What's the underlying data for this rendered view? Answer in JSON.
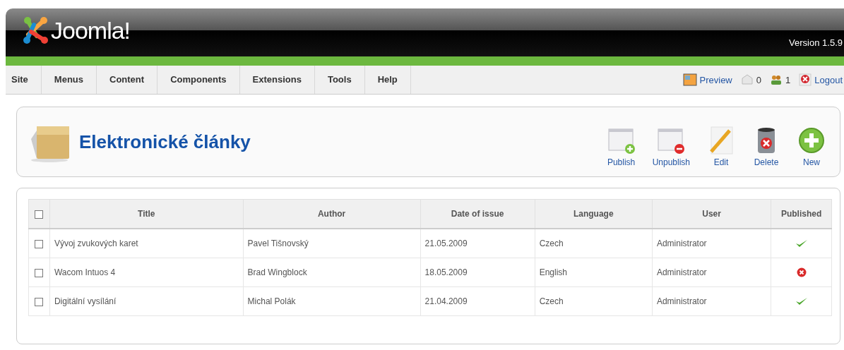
{
  "header": {
    "logo_text": "Joomla!",
    "version": "Version 1.5.9"
  },
  "menu": [
    "Site",
    "Menus",
    "Content",
    "Components",
    "Extensions",
    "Tools",
    "Help"
  ],
  "status": [
    {
      "kind": "preview",
      "label": "Preview"
    },
    {
      "kind": "messages",
      "label": "0"
    },
    {
      "kind": "users",
      "label": "1"
    },
    {
      "kind": "logout",
      "label": "Logout"
    }
  ],
  "page_title": "Elektronické články",
  "toolbar": [
    {
      "kind": "publish",
      "label": "Publish"
    },
    {
      "kind": "unpublish",
      "label": "Unpublish"
    },
    {
      "kind": "edit",
      "label": "Edit"
    },
    {
      "kind": "delete",
      "label": "Delete"
    },
    {
      "kind": "new",
      "label": "New"
    }
  ],
  "table": {
    "select_all_checked": false,
    "columns": [
      "Title",
      "Author",
      "Date of issue",
      "Language",
      "User",
      "Published"
    ],
    "rows": [
      {
        "checked": false,
        "cells": [
          "Vývoj zvukových karet",
          "Pavel Tišnovský",
          "21.05.2009",
          "Czech",
          "Administrator"
        ],
        "published": true
      },
      {
        "checked": false,
        "cells": [
          "Wacom Intuos 4",
          "Brad Wingblock",
          "18.05.2009",
          "English",
          "Administrator"
        ],
        "published": false
      },
      {
        "checked": false,
        "cells": [
          "Digitální vysílání",
          "Michal Polák",
          "21.04.2009",
          "Czech",
          "Administrator"
        ],
        "published": true
      }
    ]
  }
}
